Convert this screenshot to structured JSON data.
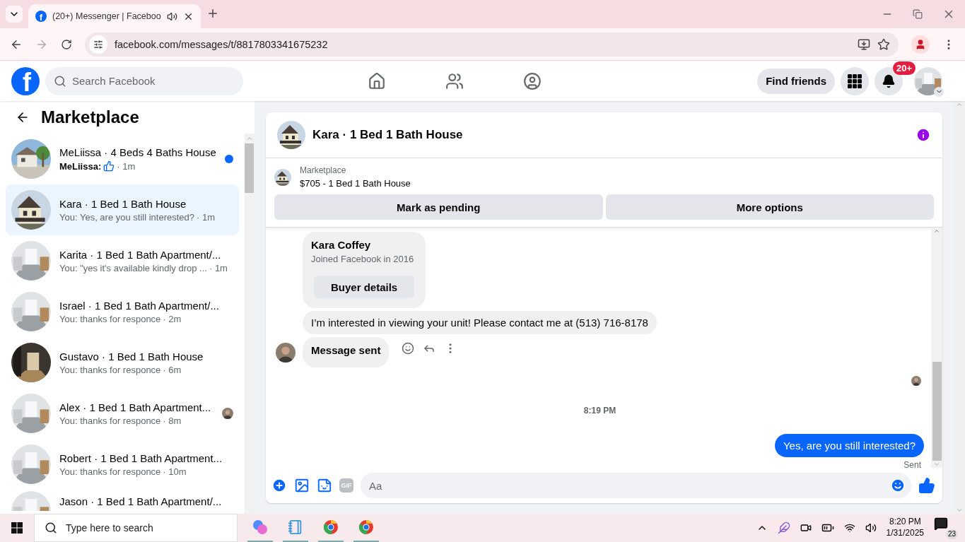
{
  "browser": {
    "tab": {
      "favicon": "f",
      "title": "(20+) Messenger | Faceboo",
      "selected": true
    },
    "url": "facebook.com/messages/t/8817803341675232"
  },
  "header": {
    "logo": "f",
    "search": {
      "placeholder": "Search Facebook"
    },
    "find_friends": "Find friends",
    "notification_count": "20+"
  },
  "sidebar": {
    "title": "Marketplace",
    "conversations": [
      {
        "title": "MeLiissa · 4 Beds 4 Baths House",
        "sender": "MeLiissa:",
        "kind": "like",
        "time": "· 1m",
        "selected": false,
        "unread": true,
        "seen": false
      },
      {
        "title": "Kara · 1 Bed 1 Bath House",
        "preview": "You: Yes, are you still interested?",
        "kind": "text",
        "time": "· 1m",
        "selected": true,
        "unread": false,
        "seen": false
      },
      {
        "title": "Karita · 1 Bed 1 Bath Apartment/...",
        "preview": "You: \"yes it's available kindly drop ...",
        "kind": "text",
        "time": "· 1m",
        "selected": false,
        "unread": false,
        "seen": false
      },
      {
        "title": "Israel · 1 Bed 1 Bath Apartment/...",
        "preview": "You: thanks for responce",
        "kind": "text",
        "time": "· 2m",
        "selected": false,
        "unread": false,
        "seen": false
      },
      {
        "title": "Gustavo · 1 Bed 1 Bath House",
        "preview": "You: thanks for responce",
        "kind": "text",
        "time": "· 6m",
        "selected": false,
        "unread": false,
        "seen": false
      },
      {
        "title": "Alex · 1 Bed 1 Bath Apartment...",
        "preview": "You: thanks for responce",
        "kind": "text",
        "time": "· 8m",
        "selected": false,
        "unread": false,
        "seen": true
      },
      {
        "title": "Robert · 1 Bed 1 Bath Apartment...",
        "preview": "You: thanks for responce",
        "kind": "text",
        "time": "· 10m",
        "selected": false,
        "unread": false,
        "seen": false
      },
      {
        "title": "Jason · 1 Bed 1 Bath Apartment/...",
        "kind": "text",
        "selected": false,
        "unread": false,
        "seen": false
      }
    ]
  },
  "chat": {
    "title": "Kara · 1 Bed 1 Bath House",
    "listing": {
      "label": "Marketplace",
      "title": "$705 - 1 Bed 1 Bath House"
    },
    "actions": [
      "Mark as pending",
      "More options"
    ],
    "messages": [
      {
        "kind": "card",
        "name": "Kara Coffey",
        "subtitle": "Joined Facebook in 2016",
        "button": "Buyer details"
      },
      {
        "kind": "incoming",
        "text": "I’m interested in viewing your unit! Please contact me at (513) 716-8178"
      },
      {
        "kind": "system",
        "text": "Message sent"
      },
      {
        "kind": "seen"
      },
      {
        "kind": "timestamp",
        "text": "8:19 PM"
      },
      {
        "kind": "outgoing",
        "text": "Yes, are you still interested?"
      },
      {
        "kind": "status",
        "text": "Sent"
      }
    ],
    "composer": {
      "placeholder": "Aa",
      "gif": "GIF"
    }
  },
  "taskbar": {
    "search": {
      "placeholder": "Type here to search"
    },
    "time": "8:20 PM",
    "date": "1/31/2025",
    "notifications": "23"
  }
}
